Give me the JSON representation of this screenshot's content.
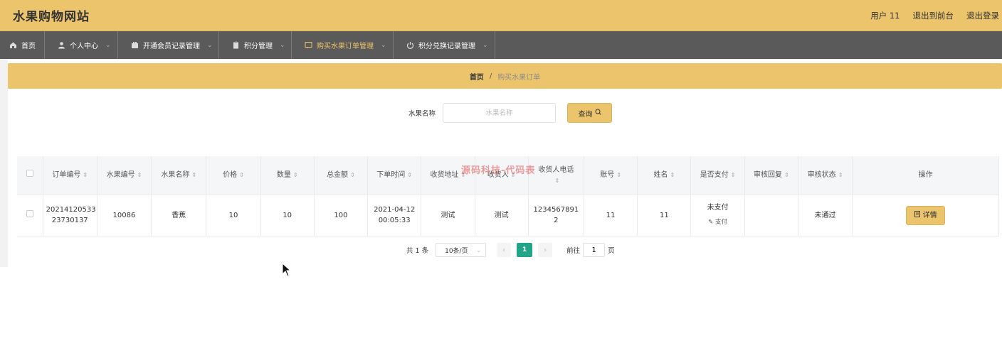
{
  "app": {
    "title": "水果购物网站",
    "user_label": "用户 11",
    "to_frontend": "退出到前台",
    "logout": "退出登录"
  },
  "nav": [
    {
      "label": "首页",
      "icon": "home-icon",
      "dropdown": false,
      "active": false
    },
    {
      "label": "个人中心",
      "icon": "user-icon",
      "dropdown": true,
      "active": false
    },
    {
      "label": "开通会员记录管理",
      "icon": "building-icon",
      "dropdown": true,
      "active": false
    },
    {
      "label": "积分管理",
      "icon": "clipboard-icon",
      "dropdown": true,
      "active": false
    },
    {
      "label": "购买水果订单管理",
      "icon": "message-icon",
      "dropdown": true,
      "active": true
    },
    {
      "label": "积分兑换记录管理",
      "icon": "power-icon",
      "dropdown": true,
      "active": false
    }
  ],
  "breadcrumb": {
    "home": "首页",
    "separator": "/",
    "current": "购买水果订单"
  },
  "search": {
    "label": "水果名称",
    "placeholder": "水果名称",
    "button": "查询"
  },
  "watermark": "源码科技-代码表",
  "table": {
    "headers": [
      "订单编号",
      "水果编号",
      "水果名称",
      "价格",
      "数量",
      "总金额",
      "下单时间",
      "收货地址",
      "收货人",
      "收货人电话",
      "账号",
      "姓名",
      "是否支付",
      "审核回复",
      "审核状态",
      "操作"
    ],
    "rows": [
      {
        "order_no_1": "20214120533",
        "order_no_2": "23730137",
        "fruit_no": "10086",
        "fruit_name": "香蕉",
        "price": "10",
        "quantity": "10",
        "total": "100",
        "date": "2021-04-12",
        "time": "00:05:33",
        "address": "测试",
        "receiver": "测试",
        "phone_1": "1234567891",
        "phone_2": "2",
        "account": "11",
        "name": "11",
        "paid": "未支付",
        "pay_action": "支付",
        "review_reply": "",
        "review_status": "未通过",
        "detail": "详情"
      }
    ]
  },
  "pagination": {
    "total": "共 1 条",
    "page_size": "10条/页",
    "current_page": "1",
    "goto_label": "前往",
    "goto_value": "1",
    "page_unit": "页"
  }
}
